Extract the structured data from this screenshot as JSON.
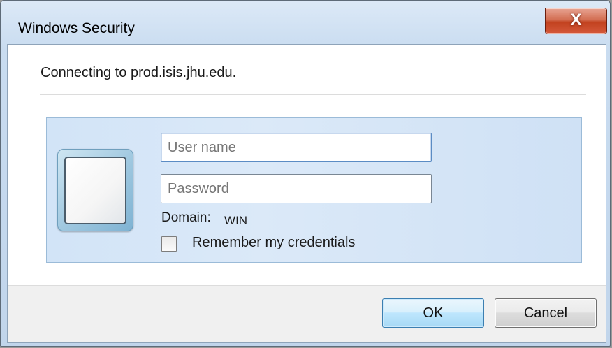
{
  "window": {
    "title": "Windows Security",
    "close_symbol": "X"
  },
  "message": "Connecting to prod.isis.jhu.edu.",
  "credentials": {
    "username": {
      "value": "",
      "placeholder": "User name"
    },
    "password": {
      "value": "",
      "placeholder": "Password"
    },
    "domain_label": "Domain:",
    "domain_value": "WIN",
    "remember_label": "Remember my credentials",
    "remember_checked": false
  },
  "buttons": {
    "ok_label": "OK",
    "cancel_label": "Cancel"
  },
  "icons": {
    "close": "close-icon",
    "user_tile": "user-tile-icon"
  },
  "colors": {
    "close_button": "#c7452a",
    "panel_background": "#d6e6f7",
    "default_button": "#bee6fd"
  }
}
